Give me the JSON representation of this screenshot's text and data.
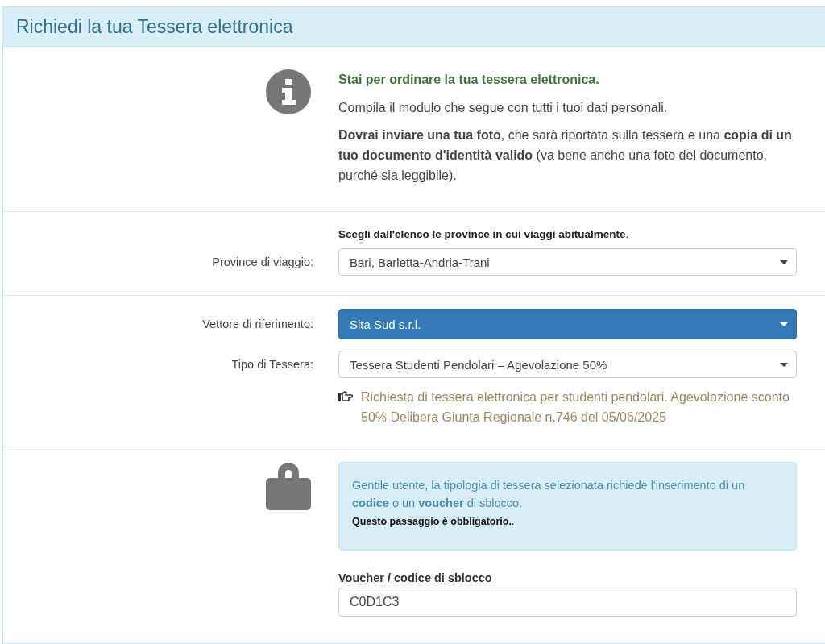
{
  "panel": {
    "title": "Richiedi la tua Tessera elettronica"
  },
  "intro": {
    "heading": "Stai per ordinare la tua tessera elettronica.",
    "text": "Compila il modulo che segue con tutti i tuoi dati personali.",
    "detail": "**Dovrai inviare una tua foto**, che sarà riportata sulla tessera e una **copia di un tuo documento d'identità valido** (va bene anche una foto del documento, purché sia leggibile)."
  },
  "province": {
    "hint": "**Scegli dall'elenco le province in cui viaggi abitualmente**.",
    "label": "Province di viaggio:",
    "value": "Bari, Barletta-Andria-Trani",
    "focused": false
  },
  "fields": [
    {
      "label": "Vettore di riferimento:",
      "value": "Sita Sud s.r.l.",
      "focused": true
    },
    {
      "label": "Tipo di Tessera:",
      "value": "Tessera Studenti Pendolari – Agevolazione 50%",
      "focused": false
    }
  ],
  "note": "Richiesta di tessera elettronica per studenti pendolari. Agevolazione sconto 50% Delibera Giunta Regionale n.746 del 05/06/2025",
  "unlock": {
    "message": "Gentile utente, la tipologia di tessera selezionata richiede l'inserimento di un **codice** o un **voucher** di sblocco.",
    "warning": "**Questo passaggio è obbligatorio.**.",
    "field_label": "Voucher / codice di sblocco",
    "value": "C0D1C3"
  }
}
